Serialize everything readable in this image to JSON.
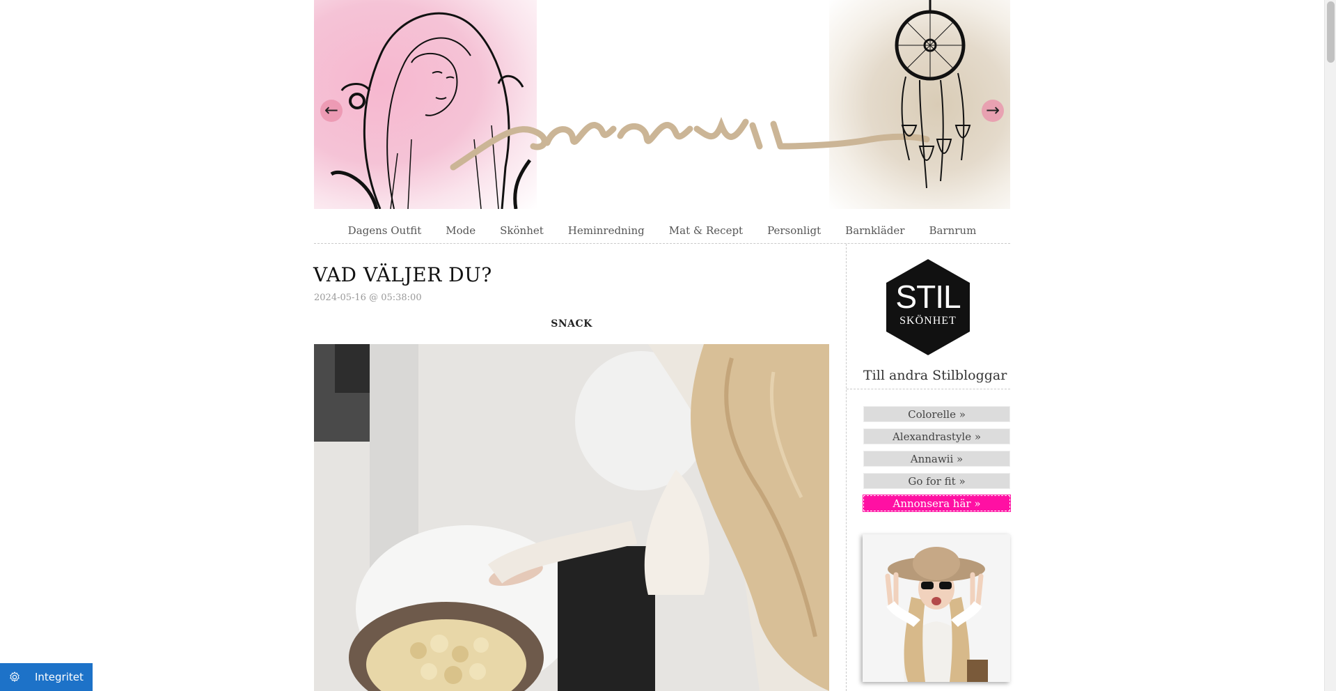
{
  "banner": {
    "logo_script": "annawii",
    "prev_arrow": "←",
    "next_arrow": "→"
  },
  "nav": {
    "items": [
      {
        "label": "Dagens Outfit"
      },
      {
        "label": "Mode"
      },
      {
        "label": "Skönhet"
      },
      {
        "label": "Heminredning"
      },
      {
        "label": "Mat & Recept"
      },
      {
        "label": "Personligt"
      },
      {
        "label": "Barnkläder"
      },
      {
        "label": "Barnrum"
      }
    ]
  },
  "post": {
    "title": "VAD VÄLJER DU?",
    "date": "2024-05-16 @ 05:38:00",
    "caption": "SNACK"
  },
  "sidebar": {
    "logo_line1": "STIL",
    "logo_line2": "SKÖNHET",
    "heading": "Till andra Stilbloggar",
    "links": [
      {
        "label": "Colorelle »"
      },
      {
        "label": "Alexandrastyle »"
      },
      {
        "label": "Annawii »"
      },
      {
        "label": "Go for fit »"
      },
      {
        "label": "Annonsera här »"
      }
    ]
  },
  "privacy": {
    "label": "Integritet",
    "icon": "gear-icon"
  },
  "colors": {
    "accent": "#ff10a3",
    "privacy_blue": "#1d72c8",
    "banner_pink": "#f5c3d6",
    "banner_beige": "#d9ccb6"
  }
}
